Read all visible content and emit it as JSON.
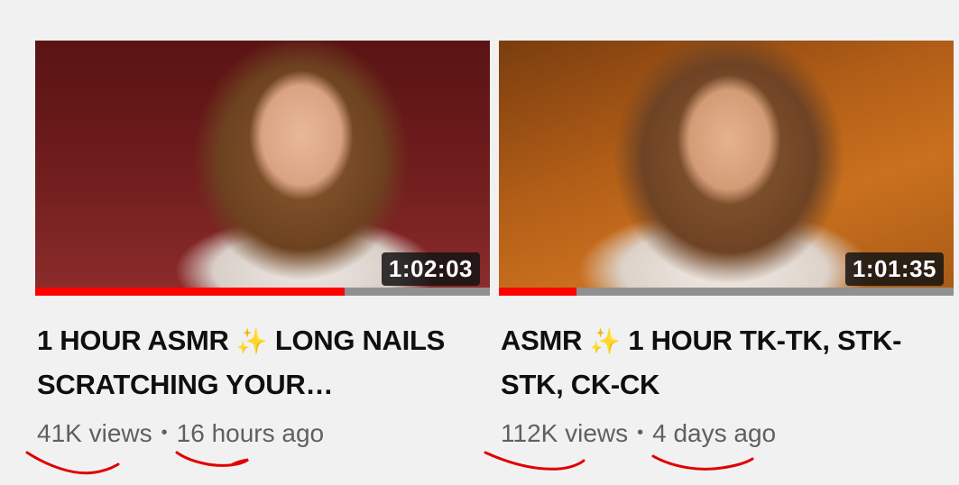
{
  "videos": [
    {
      "title_part1": "1 HOUR ASMR",
      "title_part2": "LONG NAILS SCRATCHING YOUR…",
      "duration": "1:02:03",
      "progress_pct": 68,
      "views": "41K views",
      "dot": "•",
      "age": "16 hours ago"
    },
    {
      "title_part1": "ASMR",
      "title_part2": "1 HOUR TK-TK, STK-STK, CK-CK",
      "duration": "1:01:35",
      "progress_pct": 17,
      "views": "112K views",
      "dot": "•",
      "age": "4 days ago"
    }
  ],
  "icons": {
    "sparkle": "✨"
  },
  "colors": {
    "progress_watched": "#ff0000",
    "progress_remaining": "#909090",
    "annotation_ink": "#e00000"
  }
}
